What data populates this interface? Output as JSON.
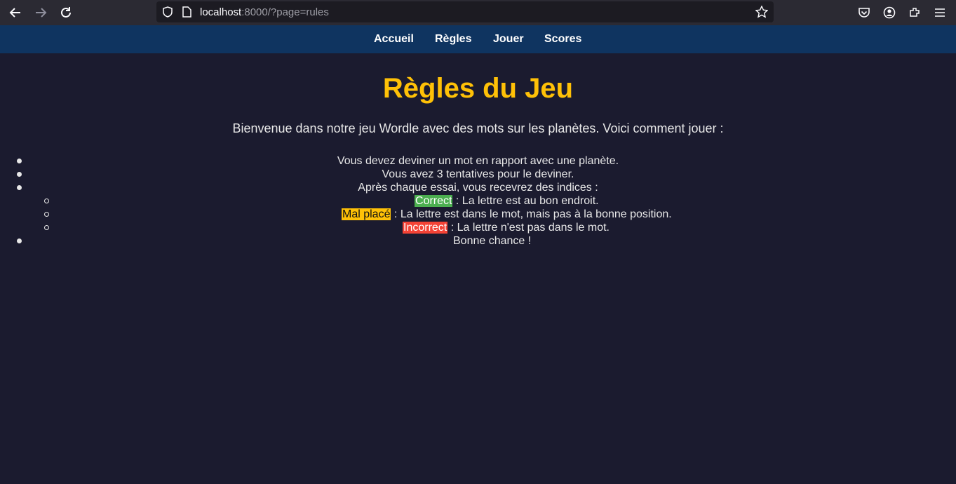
{
  "browser": {
    "url_host": "localhost",
    "url_rest": ":8000/?page=rules"
  },
  "nav": {
    "items": [
      {
        "label": "Accueil"
      },
      {
        "label": "Règles"
      },
      {
        "label": "Jouer"
      },
      {
        "label": "Scores"
      }
    ]
  },
  "main": {
    "title": "Règles du Jeu",
    "intro": "Bienvenue dans notre jeu Wordle avec des mots sur les planètes. Voici comment jouer :",
    "rules": [
      "Vous devez deviner un mot en rapport avec une planète.",
      "Vous avez 3 tentatives pour le deviner.",
      "Après chaque essai, vous recevrez des indices :",
      "Bonne chance !"
    ],
    "hints": [
      {
        "tag": "Correct",
        "text": " : La lettre est au bon endroit.",
        "color": "#4caf50"
      },
      {
        "tag": "Mal placé",
        "text": " : La lettre est dans le mot, mais pas à la bonne position.",
        "color": "#ffc107"
      },
      {
        "tag": "Incorrect",
        "text": " : La lettre n'est pas dans le mot.",
        "color": "#f44336"
      }
    ]
  },
  "colors": {
    "background": "#1b1b2f",
    "nav": "#0f3460",
    "accent": "#ffc107"
  },
  "icons": [
    "back-arrow-icon",
    "forward-arrow-icon",
    "reload-icon",
    "shield-icon",
    "page-icon",
    "star-icon",
    "pocket-icon",
    "account-icon",
    "extensions-icon",
    "menu-icon"
  ]
}
